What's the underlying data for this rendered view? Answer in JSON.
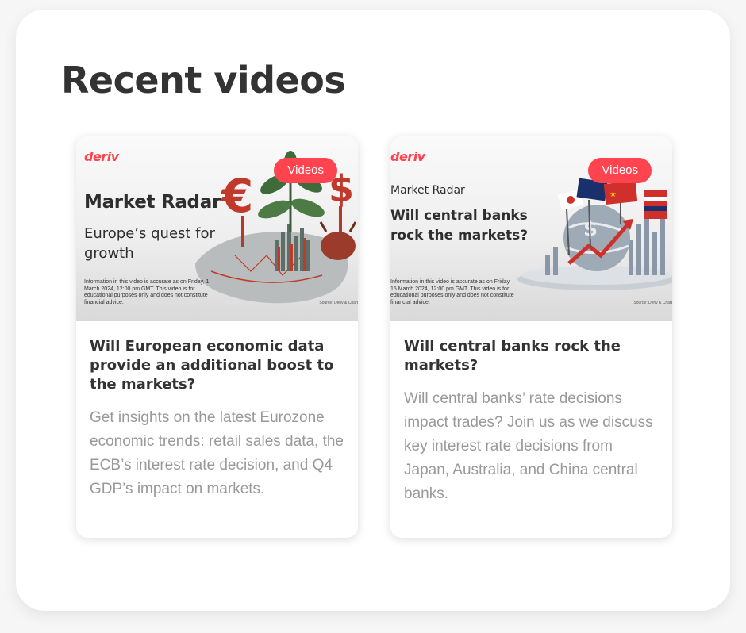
{
  "section": {
    "title": "Recent videos"
  },
  "cards": [
    {
      "logo": "deriv",
      "badge": "Videos",
      "thumb_kicker": "Market Radar",
      "thumb_headline": "Europe’s quest for growth",
      "thumb_disclaimer": "Information in this video is accurate as on Friday, 1 March 2024, 12:00 pm GMT. This video is for educational purposes only and does not constitute financial advice.",
      "thumb_source": "Source: Deriv & Chart",
      "title": "Will European economic data provide an additional boost to the markets?",
      "description": "Get insights on the latest Eurozone economic trends: retail sales data, the ECB’s interest rate decision, and Q4 GDP’s impact on markets."
    },
    {
      "logo": "deriv",
      "badge": "Videos",
      "thumb_kicker": "Market Radar",
      "thumb_headline": "Will central banks rock the markets?",
      "thumb_disclaimer": "Information in this video is accurate as on Friday, 15 March 2024, 12:00 pm GMT. This video is for educational purposes only and does not constitute financial advice.",
      "thumb_source": "Source: Deriv & Chart",
      "title": "Will central banks rock the markets?",
      "description": "Will central banks’ rate decisions impact trades? Join us as we discuss key interest rate decisions from Japan, Australia, and China central banks."
    }
  ],
  "colors": {
    "brand": "#ff444f",
    "heading": "#333333",
    "muted": "#999999"
  }
}
